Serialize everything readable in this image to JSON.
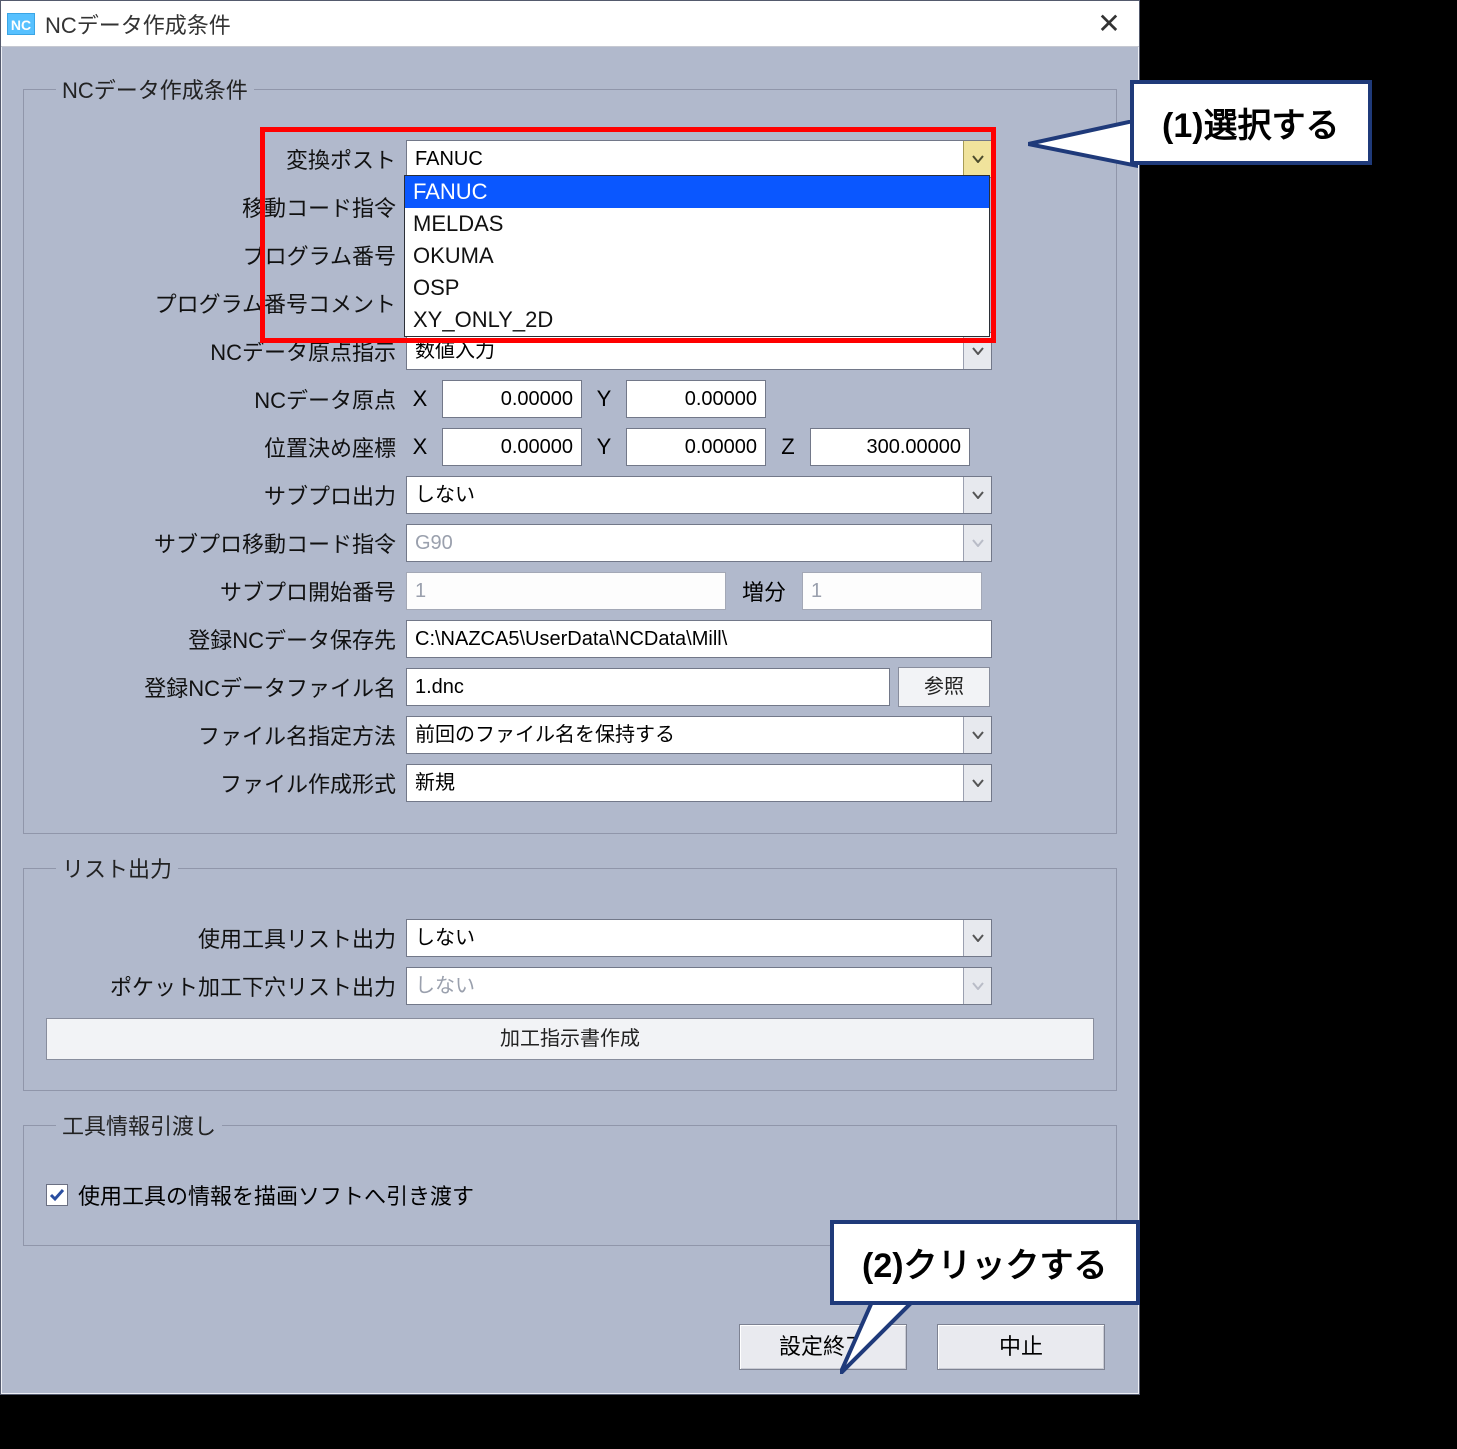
{
  "window": {
    "icon_text": "NC",
    "title": "NCデータ作成条件",
    "close_glyph": "✕"
  },
  "group_main": {
    "legend": "NCデータ作成条件",
    "post": {
      "label": "変換ポスト",
      "value": "FANUC"
    },
    "post_options": {
      "o0": "FANUC",
      "o1": "MELDAS",
      "o2": "OKUMA",
      "o3": "OSP",
      "o4": "XY_ONLY_2D"
    },
    "move_code": {
      "label": "移動コード指令"
    },
    "prog_no": {
      "label": "プログラム番号"
    },
    "prog_comment": {
      "label": "プログラム番号コメント"
    },
    "origin_mode": {
      "label": "NCデータ原点指示",
      "value": "数値入力"
    },
    "origin": {
      "label": "NCデータ原点",
      "x_lbl": "X",
      "x": "0.00000",
      "y_lbl": "Y",
      "y": "0.00000"
    },
    "pos": {
      "label": "位置決め座標",
      "x_lbl": "X",
      "x": "0.00000",
      "y_lbl": "Y",
      "y": "0.00000",
      "z_lbl": "Z",
      "z": "300.00000"
    },
    "subpro_out": {
      "label": "サブプロ出力",
      "value": "しない"
    },
    "subpro_move_code": {
      "label": "サブプロ移動コード指令",
      "value": "G90"
    },
    "subpro_start": {
      "label": "サブプロ開始番号",
      "value": "1",
      "inc_label": "増分",
      "inc_value": "1"
    },
    "save_dir": {
      "label": "登録NCデータ保存先",
      "value": "C:\\NAZCA5\\UserData\\NCData\\Mill\\"
    },
    "save_file": {
      "label": "登録NCデータファイル名",
      "value": "1.dnc",
      "browse": "参照"
    },
    "fname_method": {
      "label": "ファイル名指定方法",
      "value": "前回のファイル名を保持する"
    },
    "file_mode": {
      "label": "ファイル作成形式",
      "value": "新規"
    }
  },
  "group_list": {
    "legend": "リスト出力",
    "tool_list": {
      "label": "使用工具リスト出力",
      "value": "しない"
    },
    "pocket_list": {
      "label": "ポケット加工下穴リスト出力",
      "value": "しない"
    },
    "make_sheet_btn": "加工指示書作成"
  },
  "group_tool": {
    "legend": "工具情報引渡し",
    "check_label": "使用工具の情報を描画ソフトへ引き渡す",
    "checked": true
  },
  "buttons": {
    "ok": "設定終了",
    "cancel": "中止"
  },
  "annotations": {
    "a1": "(1)選択する",
    "a2": "(2)クリックする"
  }
}
